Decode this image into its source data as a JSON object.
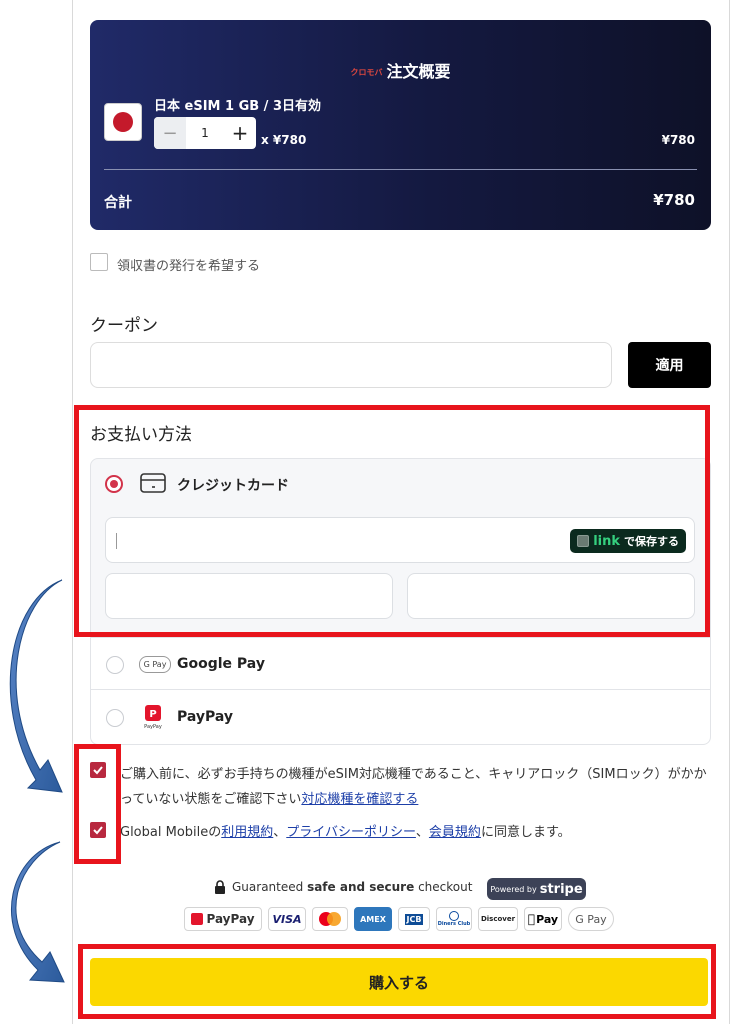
{
  "summary": {
    "logo_text": "クロモバ",
    "title": "注文概要",
    "product_name": "日本 eSIM 1 GB / 3日有効",
    "quantity": "1",
    "unit_price": "x ¥780",
    "line_price": "¥780",
    "total_label": "合計",
    "total_value": "¥780"
  },
  "receipt": {
    "label": "領収書の発行を希望する",
    "checked": false
  },
  "coupon": {
    "title": "クーポン",
    "value": "",
    "apply_label": "適用"
  },
  "payment": {
    "title": "お支払い方法",
    "selected": "card",
    "card_label": "クレジットカード",
    "link_brand": "link",
    "link_save": "で保存する",
    "card_number": "",
    "card_expiry": "",
    "card_cvc": "",
    "gpay_badge": "G Pay",
    "gpay_label": "Google Pay",
    "paypay_label": "PayPay",
    "paypay_small": "PayPay"
  },
  "agreements": {
    "a1_text": "ご購入前に、必ずお手持ちの機種がeSIM対応機種であること、キャリアロック（SIMロック）がかかっていない状態をご確認下さい",
    "a1_link": "対応機種を確認する",
    "a2_prefix": "Global Mobileの",
    "a2_link1": "利用規約",
    "a2_sep1": "、",
    "a2_link2": "プライバシーポリシー",
    "a2_sep2": "、",
    "a2_link3": "会員規約",
    "a2_suffix": "に同意します。",
    "a1_checked": true,
    "a2_checked": true
  },
  "secure": {
    "pre": "Guaranteed ",
    "bold": "safe and secure",
    "post": " checkout",
    "powered": "Powered by",
    "stripe": "stripe"
  },
  "badges": {
    "paypay": "PayPay",
    "visa": "VISA",
    "amex": "AMEX",
    "jcb": "JCB",
    "diners": "Diners Club",
    "discover": "Discover",
    "applepay": "Pay",
    "googlepay": "G Pay"
  },
  "buy_label": "購入する",
  "colors": {
    "highlight": "#e8141c",
    "accent": "#b8283f",
    "buy": "#fbd800",
    "summary_bg": "#141940"
  }
}
